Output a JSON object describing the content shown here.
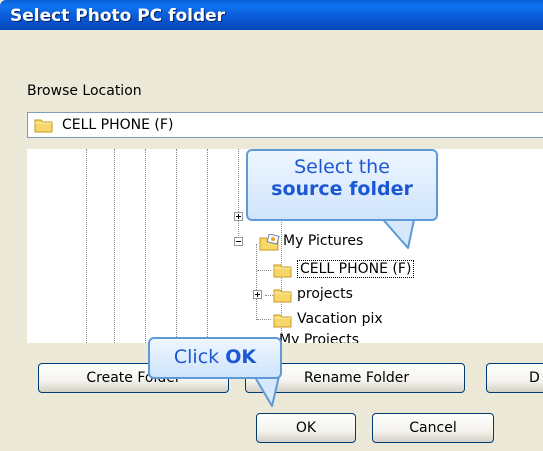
{
  "colors": {
    "titlebar": "#0a58d4",
    "dialog_bg": "#ece9d8",
    "callout_text": "#1c58d4",
    "callout_border": "#5f9ad8"
  },
  "window": {
    "title": "Select Photo PC folder"
  },
  "browse": {
    "label": "Browse Location",
    "value": "CELL PHONE (F)",
    "icon": "folder-icon"
  },
  "tree": {
    "items": [
      {
        "label": "My Pictures",
        "icon": "pictures-folder-icon",
        "expanded": true
      },
      {
        "label": "CELL PHONE (F)",
        "icon": "folder-icon",
        "selected": true
      },
      {
        "label": "projects",
        "icon": "folder-icon",
        "expandable": true
      },
      {
        "label": "Vacation pix",
        "icon": "folder-icon"
      },
      {
        "label": "My Projects",
        "icon": "folder-icon"
      }
    ]
  },
  "buttons": {
    "create_folder": "Create Folder",
    "rename_folder": "Rename Folder",
    "third": "D",
    "ok": "OK",
    "cancel": "Cancel"
  },
  "callouts": {
    "source": {
      "line1": "Select the",
      "line2": "source folder"
    },
    "ok": {
      "text": "Click ",
      "bold": "OK"
    }
  }
}
